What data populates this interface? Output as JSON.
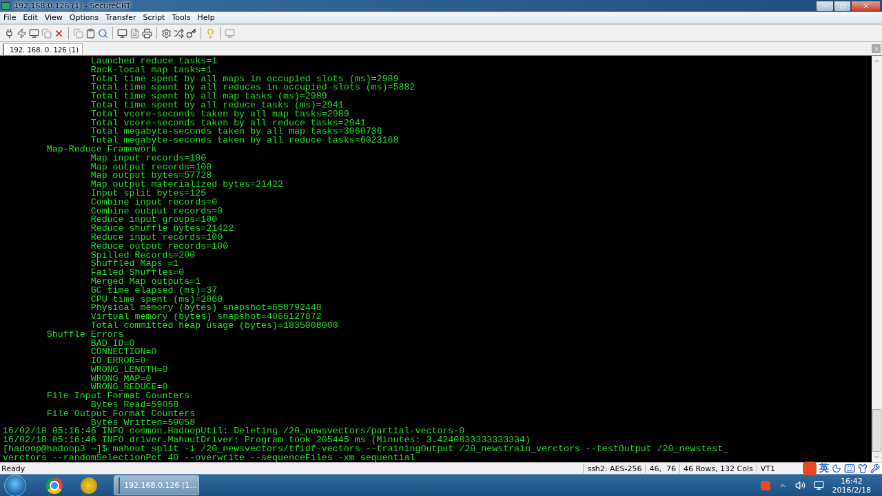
{
  "window": {
    "title": "192.168.0.126 (1) - SecureCRT"
  },
  "menu": [
    "File",
    "Edit",
    "View",
    "Options",
    "Transfer",
    "Script",
    "Tools",
    "Help"
  ],
  "tabs": [
    {
      "label": "192. 168. 0. 126  (1)",
      "selected": true
    }
  ],
  "terminal": {
    "lines": [
      "                Launched reduce tasks=1",
      "                Rack-local map tasks=1",
      "                Total time spent by all maps in occupied slots (ms)=2989",
      "                Total time spent by all reduces in occupied slots (ms)=5882",
      "                Total time spent by all map tasks (ms)=2989",
      "                Total time spent by all reduce tasks (ms)=2941",
      "                Total vcore-seconds taken by all map tasks=2989",
      "                Total vcore-seconds taken by all reduce tasks=2941",
      "                Total megabyte-seconds taken by all map tasks=3060736",
      "                Total megabyte-seconds taken by all reduce tasks=6023168",
      "        Map-Reduce Framework",
      "                Map input records=100",
      "                Map output records=100",
      "                Map output bytes=57728",
      "                Map output materialized bytes=21422",
      "                Input split bytes=125",
      "                Combine input records=0",
      "                Combine output records=0",
      "                Reduce input groups=100",
      "                Reduce shuffle bytes=21422",
      "                Reduce input records=100",
      "                Reduce output records=100",
      "                Spilled Records=200",
      "                Shuffled Maps =1",
      "                Failed Shuffles=0",
      "                Merged Map outputs=1",
      "                GC time elapsed (ms)=37",
      "                CPU time spent (ms)=2060",
      "                Physical memory (bytes) snapshot=658792448",
      "                Virtual memory (bytes) snapshot=4066127872",
      "                Total committed heap usage (bytes)=1835008000",
      "        Shuffle Errors",
      "                BAD_ID=0",
      "                CONNECTION=0",
      "                IO_ERROR=0",
      "                WRONG_LENGTH=0",
      "                WRONG_MAP=0",
      "                WRONG_REDUCE=0",
      "        File Input Format Counters ",
      "                Bytes Read=59058",
      "        File Output Format Counters ",
      "                Bytes Written=59058",
      "16/02/18 05:16:46 INFO common.HadoopUtil: Deleting /20_newsvectors/partial-vectors-0",
      "16/02/18 05:16:46 INFO driver.MahoutDriver: Program took 205445 ms (Minutes: 3.4240833333333334)",
      "[hadoop@hadoop3 ~]$ mahout split -i /20_newsvectors/tfidf-vectors --trainingOutput /20_newstrain_verctors --testOutput /20_newstest_",
      "verctors --randomSelectionPct 40 --overwrite --sequenceFiles -xm sequential"
    ]
  },
  "status_bar": {
    "message": "Ready",
    "cipher": "ssh2: AES-256",
    "position": "46,  76",
    "size": "46 Rows, 132 Cols",
    "emulation": "VT1"
  },
  "ime_bar": {
    "language": "英"
  },
  "taskbar": {
    "task": "192.168.0.126 (1...",
    "time": "16:42",
    "date": "2016/2/18"
  }
}
